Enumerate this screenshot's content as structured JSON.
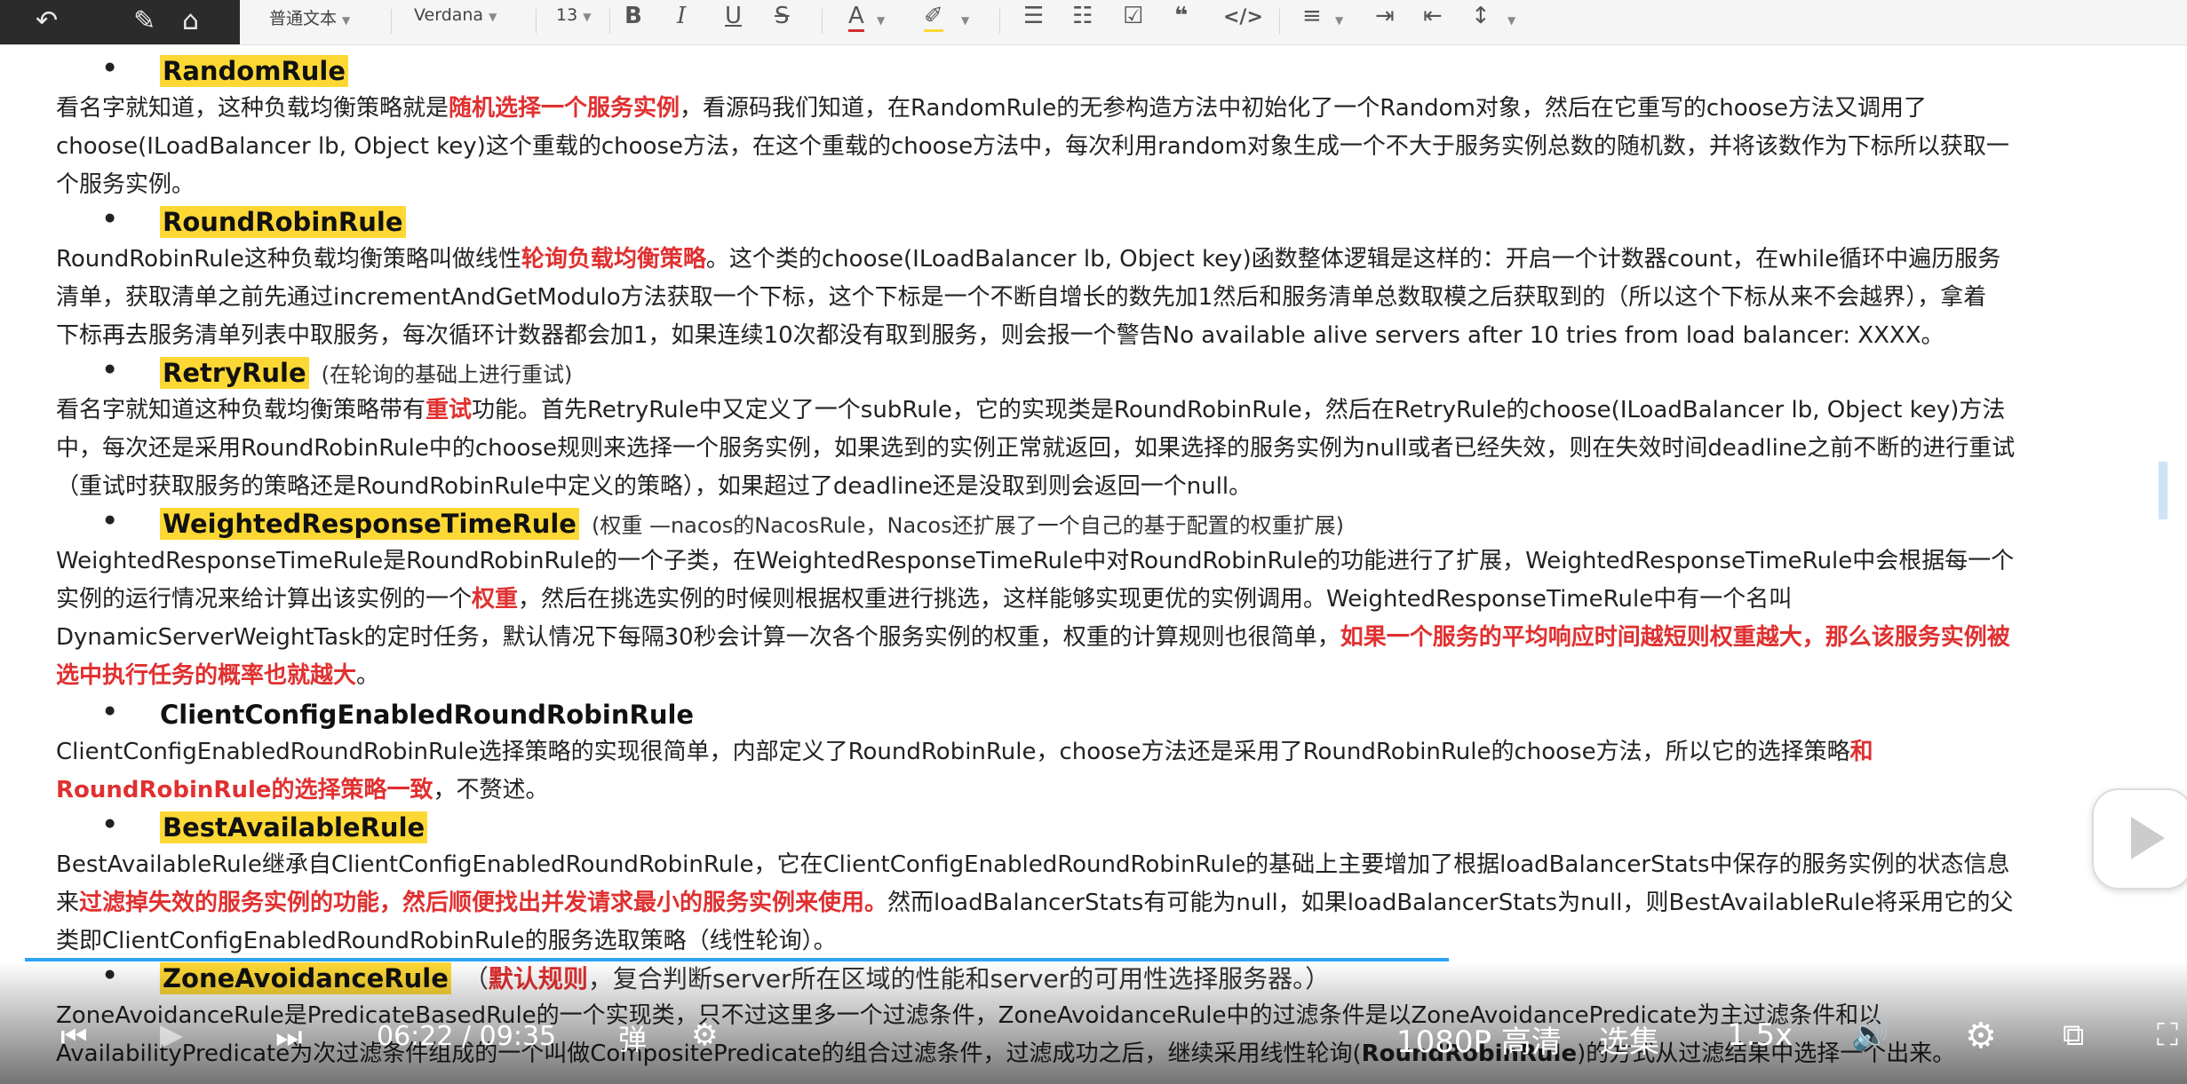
{
  "toolbar": {
    "style_label": "普通文本",
    "font_label": "Verdana",
    "size_label": "13",
    "icons": [
      "bold",
      "italic",
      "underline",
      "strikethrough",
      "font-color",
      "highlight",
      "bullet-list",
      "numbered-list",
      "checklist",
      "quote",
      "code",
      "align",
      "indent",
      "outdent",
      "line-height"
    ]
  },
  "sections": [
    {
      "title": "RandomRule",
      "note": "",
      "lines": [
        [
          [
            "看名字就知道，这种负载均衡策略就是",
            ""
          ],
          [
            "随机选择一个服务实例",
            "red"
          ],
          [
            "，看源码我们知道，在RandomRule的无参构造方法中初始化了一个Random对象，然后在它重写的choose方法又调用了",
            ""
          ]
        ],
        [
          [
            "choose(ILoadBalancer lb, Object key)这个重载的choose方法，在这个重载的choose方法中，每次利用random对象生成一个不大于服务实例总数的随机数，并将该数作为下标所以获取一",
            ""
          ]
        ],
        [
          [
            "个服务实例。",
            ""
          ]
        ]
      ]
    },
    {
      "title": "RoundRobinRule",
      "note": "",
      "lines": [
        [
          [
            "RoundRobinRule这种负载均衡策略叫做线性",
            ""
          ],
          [
            "轮询负载均衡策略",
            "red"
          ],
          [
            "。这个类的choose(ILoadBalancer lb, Object key)函数整体逻辑是这样的：开启一个计数器count，在while循环中遍历服务",
            ""
          ]
        ],
        [
          [
            "清单，获取清单之前先通过incrementAndGetModulo方法获取一个下标，这个下标是一个不断自增长的数先加1然后和服务清单总数取模之后获取到的（所以这个下标从来不会越界），拿着",
            ""
          ]
        ],
        [
          [
            "下标再去服务清单列表中取服务，每次循环计数器都会加1，如果连续10次都没有取到服务，则会报一个警告No available alive servers after 10 tries from load balancer: XXXX。",
            ""
          ]
        ]
      ]
    },
    {
      "title": "RetryRule",
      "note": "(在轮询的基础上进行重试)",
      "lines": [
        [
          [
            "看名字就知道这种负载均衡策略带有",
            ""
          ],
          [
            "重试",
            "red"
          ],
          [
            "功能。首先RetryRule中又定义了一个subRule，它的实现类是RoundRobinRule，然后在RetryRule的choose(ILoadBalancer lb, Object key)方法",
            ""
          ]
        ],
        [
          [
            "中，每次还是采用RoundRobinRule中的choose规则来选择一个服务实例，如果选到的实例正常就返回，如果选择的服务实例为null或者已经失效，则在失效时间deadline之前不断的进行重试",
            ""
          ]
        ],
        [
          [
            "（重试时获取服务的策略还是RoundRobinRule中定义的策略），如果超过了deadline还是没取到则会返回一个null。",
            ""
          ]
        ]
      ]
    },
    {
      "title": "WeightedResponseTimeRule",
      "note": "(权重 —nacos的NacosRule，Nacos还扩展了一个自己的基于配置的权重扩展)",
      "lines": [
        [
          [
            "WeightedResponseTimeRule是RoundRobinRule的一个子类，在WeightedResponseTimeRule中对RoundRobinRule的功能进行了扩展，WeightedResponseTimeRule中会根据每一个",
            ""
          ]
        ],
        [
          [
            "实例的运行情况来给计算出该实例的一个",
            ""
          ],
          [
            "权重",
            "red"
          ],
          [
            "，然后在挑选实例的时候则根据权重进行挑选，这样能够实现更优的实例调用。WeightedResponseTimeRule中有一个名叫",
            ""
          ]
        ],
        [
          [
            "DynamicServerWeightTask的定时任务，默认情况下每隔30秒会计算一次各个服务实例的权重，权重的计算规则也很简单，",
            ""
          ],
          [
            "如果一个服务的平均响应时间越短则权重越大，那么该服务实例被",
            "red"
          ]
        ],
        [
          [
            "选中执行任务的概率也就越大",
            "red"
          ],
          [
            "。",
            ""
          ]
        ]
      ]
    },
    {
      "title": "ClientConfigEnabledRoundRobinRule",
      "note": "",
      "lines": [
        [
          [
            "ClientConfigEnabledRoundRobinRule选择策略的实现很简单，内部定义了RoundRobinRule，choose方法还是采用了RoundRobinRule的choose方法，所以它的选择策略",
            ""
          ],
          [
            "和",
            "red"
          ]
        ],
        [
          [
            "RoundRobinRule的选择策略一致",
            "red"
          ],
          [
            "，不赘述。",
            ""
          ]
        ]
      ]
    },
    {
      "title": "BestAvailableRule",
      "note": "",
      "lines": [
        [
          [
            "BestAvailableRule继承自ClientConfigEnabledRoundRobinRule，它在ClientConfigEnabledRoundRobinRule的基础上主要增加了根据loadBalancerStats中保存的服务实例的状态信息",
            ""
          ]
        ],
        [
          [
            "来",
            ""
          ],
          [
            "过滤掉失效的服务实例的功能，然后顺便找出并发请求最小的服务实例来使用。",
            "red"
          ],
          [
            "然而loadBalancerStats有可能为null，如果loadBalancerStats为null，则BestAvailableRule将采用它的父",
            ""
          ]
        ],
        [
          [
            "类即ClientConfigEnabledRoundRobinRule的服务选取策略（线性轮询）。",
            ""
          ]
        ]
      ]
    },
    {
      "title": "ZoneAvoidanceRule",
      "note_parts": [
        [
          "（",
          ""
        ],
        [
          "默认规则",
          "red"
        ],
        [
          "，复合判断server所在区域的性能和server的可用性选择服务器。）",
          ""
        ]
      ],
      "lines": [
        [
          [
            "ZoneAvoidanceRule是PredicateBasedRule的一个实现类，只不过这里多一个过滤条件，ZoneAvoidanceRule中的过滤条件是以ZoneAvoidancePredicate为主过滤条件和以",
            ""
          ]
        ],
        [
          [
            "AvailabilityPredicate为次过滤条件组成的一个叫做CompositePredicate的组合过滤条件，过滤成功之后，继续采用线性轮询(",
            ""
          ],
          [
            "RoundRobinRule",
            "bold"
          ],
          [
            ")的方式从过滤结果中选择一个出来。",
            ""
          ]
        ]
      ]
    }
  ],
  "player": {
    "current_time": "06:22",
    "separator": "/",
    "duration": "09:35",
    "progress": 0.665,
    "danmaku_label": "弹",
    "quality_label": "1080P 高清",
    "episodes_label": "选集",
    "speed_label": "1.5x"
  }
}
